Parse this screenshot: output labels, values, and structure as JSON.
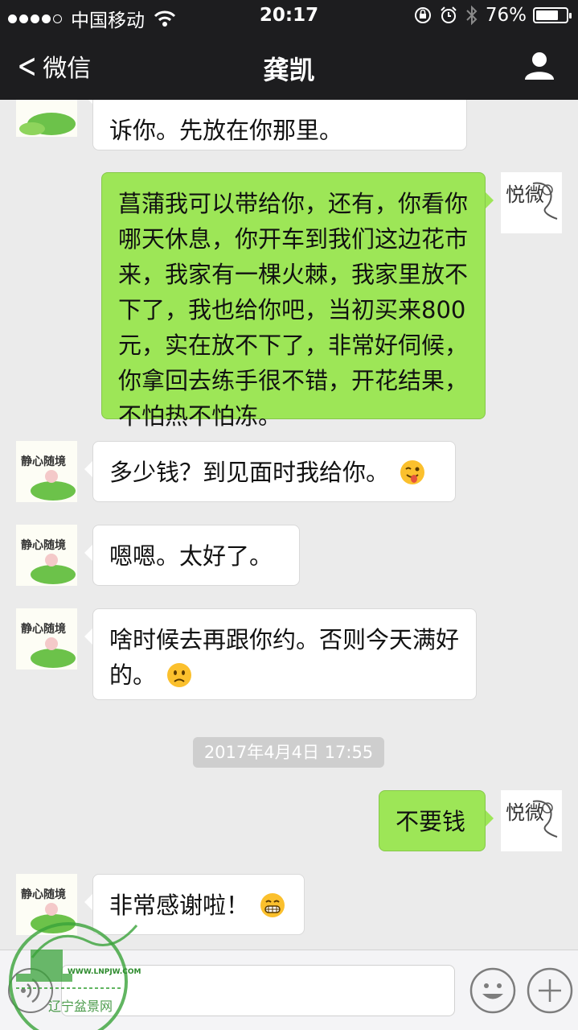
{
  "status_bar": {
    "carrier": "中国移动",
    "time": "20:17",
    "battery": "76%",
    "battery_level": 0.76,
    "signal_icon": "signal-dots-icon",
    "wifi_icon": "wifi-icon"
  },
  "nav": {
    "back_label": "微信",
    "title": "龚凯",
    "profile_icon": "person-icon"
  },
  "messages": [
    {
      "side": "in",
      "text": "诉你。先放在你那里。"
    },
    {
      "side": "out",
      "text": "菖蒲我可以带给你，还有，你看你哪天休息，你开车到我们这边花市来，我家有一棵火棘，我家里放不下了，我也给你吧，当初买来800元，实在放不下了，非常好伺候，你拿回去练手很不错，开花结果，不怕热不怕冻。"
    },
    {
      "side": "in",
      "text": "多少钱？到见面时我给你。",
      "emoji": "winking-tongue-emoji"
    },
    {
      "side": "in",
      "text": "嗯嗯。太好了。"
    },
    {
      "side": "in",
      "text": "啥时候去再跟你约。否则今天满好的。",
      "emoji": "frowning-emoji"
    },
    {
      "side": "out",
      "text": "不要钱"
    },
    {
      "side": "in",
      "text": "非常感谢啦！",
      "emoji": "grinning-emoji"
    }
  ],
  "timestamp": "2017年4月4日 17:55",
  "avatars": {
    "friend_text": "静心随境",
    "me_text": "悦微"
  },
  "input_bar": {
    "value": "",
    "voice_icon": "voice-icon",
    "emoji_icon": "emoji-icon",
    "plus_icon": "plus-icon"
  },
  "watermark": {
    "url": "WWW.LNPJW.COM",
    "name": "辽宁盆景网"
  },
  "colors": {
    "bar": "#1d1d1f",
    "background": "#ebebeb",
    "bubble_out": "#9de657",
    "bubble_in": "#ffffff"
  }
}
